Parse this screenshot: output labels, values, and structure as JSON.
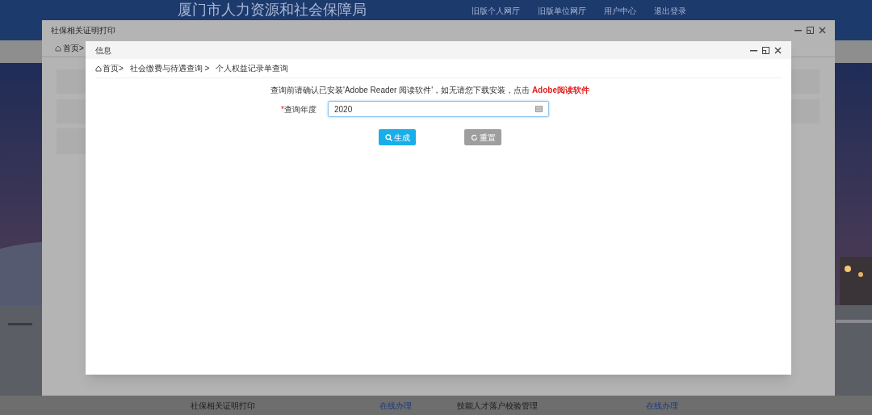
{
  "site": {
    "title": "厦门市人力资源和社会保障局",
    "nav": [
      "旧版个人网厅",
      "旧版单位网厅",
      "用户中心",
      "退出登录"
    ]
  },
  "services": [
    {
      "name": "社保相关证明打印",
      "action": "在线办理"
    },
    {
      "name": "技能人才落户校验管理",
      "action": "在线办理"
    }
  ],
  "outer_window": {
    "title": "社保相关证明打印",
    "tab": "首页>"
  },
  "dialog": {
    "title": "信息",
    "breadcrumb": [
      "首页>",
      "社会缴费与待遇查询 >",
      "个人权益记录单查询"
    ],
    "notice": "查询前请确认已安装'Adobe Reader 阅读软件'，如无请您下载安装，点击 ",
    "notice_link": "Adobe阅读软件",
    "field": {
      "required_mark": "*",
      "label": "查询年度",
      "value": "2020"
    },
    "buttons": [
      {
        "label": "生成",
        "kind": "search",
        "disabled": false
      },
      {
        "label": "重置",
        "kind": "reset",
        "disabled": true
      }
    ]
  }
}
